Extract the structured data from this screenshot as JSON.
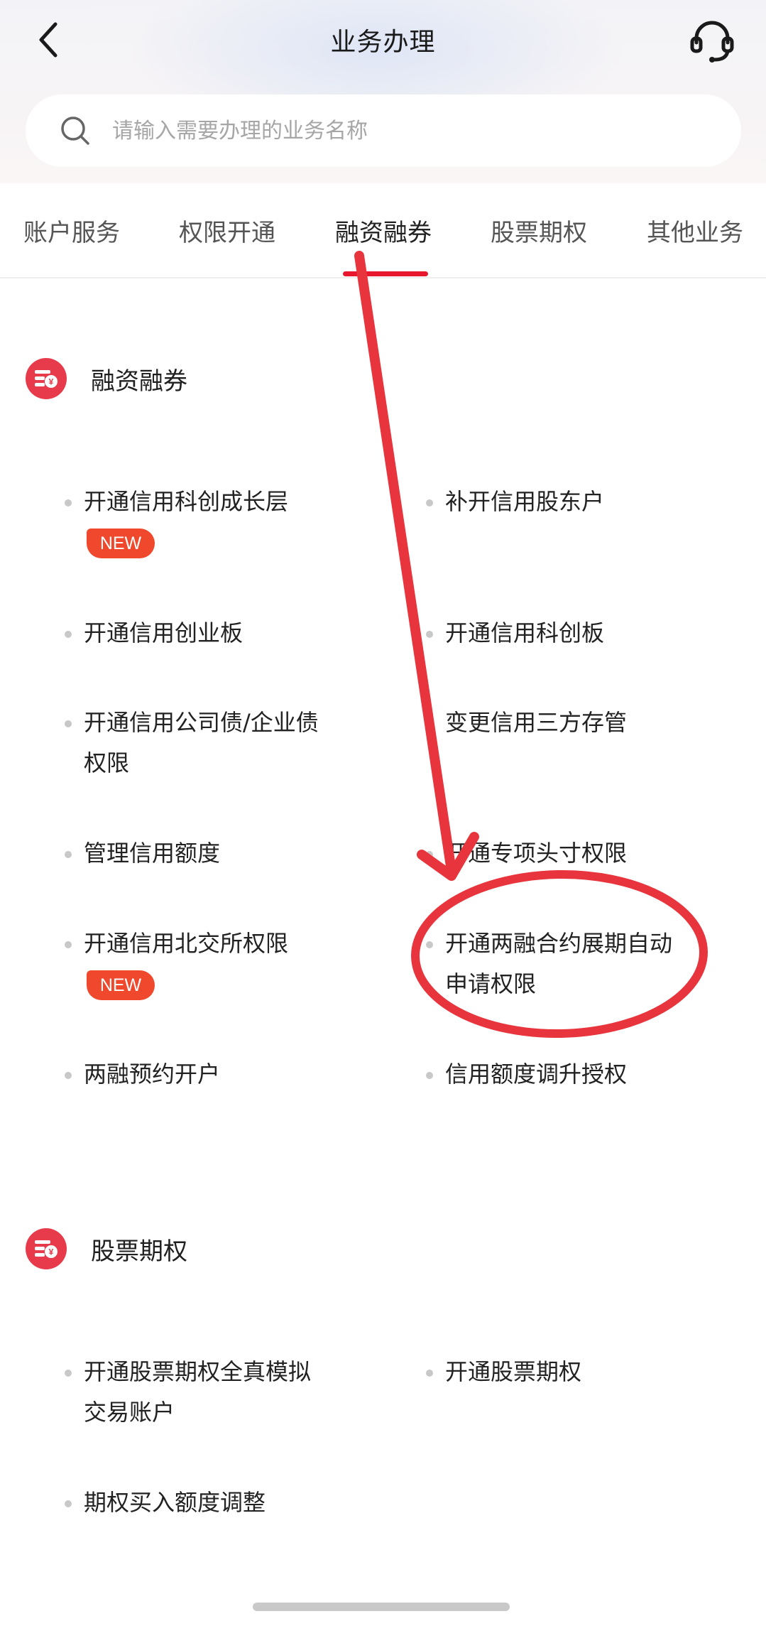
{
  "header": {
    "title": "业务办理",
    "back_icon": "chevron-left-icon",
    "service_icon": "headset-icon"
  },
  "search": {
    "placeholder": "请输入需要办理的业务名称",
    "icon": "search-icon"
  },
  "tabs": [
    {
      "label": "账户服务",
      "active": false
    },
    {
      "label": "权限开通",
      "active": false
    },
    {
      "label": "融资融券",
      "active": true
    },
    {
      "label": "股票期权",
      "active": false
    },
    {
      "label": "其他业务",
      "active": false
    }
  ],
  "sections": [
    {
      "title": "融资融券",
      "items": [
        {
          "line1": "开通信用科创成长层",
          "line2": "",
          "badge": "NEW"
        },
        {
          "line1": "补开信用股东户",
          "line2": "",
          "badge": ""
        },
        {
          "line1": "开通信用创业板",
          "line2": "",
          "badge": ""
        },
        {
          "line1": "开通信用科创板",
          "line2": "",
          "badge": ""
        },
        {
          "line1": "开通信用公司债/企业债",
          "line2": "权限",
          "badge": ""
        },
        {
          "line1": "变更信用三方存管",
          "line2": "",
          "badge": ""
        },
        {
          "line1": "管理信用额度",
          "line2": "",
          "badge": ""
        },
        {
          "line1": "开通专项头寸权限",
          "line2": "",
          "badge": ""
        },
        {
          "line1": "开通信用北交所权限",
          "line2": "",
          "badge": "NEW"
        },
        {
          "line1": "开通两融合约展期自动",
          "line2": "申请权限",
          "badge": ""
        },
        {
          "line1": "两融预约开户",
          "line2": "",
          "badge": ""
        },
        {
          "line1": "信用额度调升授权",
          "line2": "",
          "badge": ""
        }
      ]
    },
    {
      "title": "股票期权",
      "items": [
        {
          "line1": "开通股票期权全真模拟",
          "line2": "交易账户",
          "badge": ""
        },
        {
          "line1": "开通股票期权",
          "line2": "",
          "badge": ""
        },
        {
          "line1": "期权买入额度调整",
          "line2": "",
          "badge": ""
        }
      ]
    }
  ],
  "colors": {
    "accent": "#e8172e",
    "badge": "#f0482c",
    "section_icon": "#e73b4b",
    "annotation": "#e8343c"
  }
}
